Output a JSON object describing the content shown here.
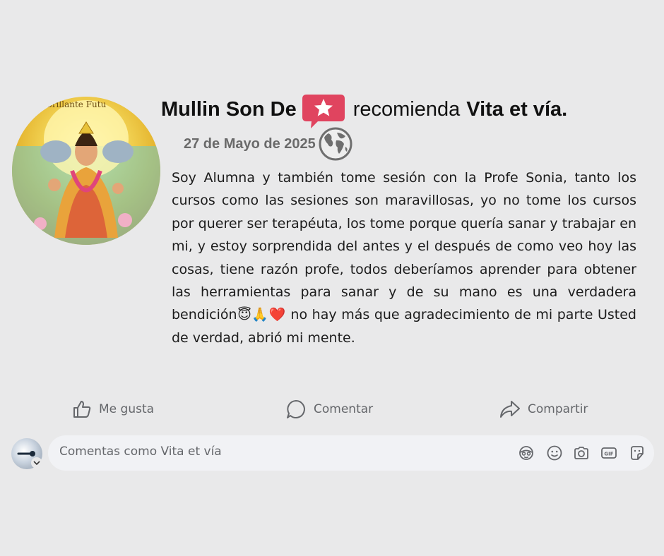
{
  "post": {
    "author": "Mullin Son De",
    "action_text": "recomienda",
    "page_name": "Vita et vía.",
    "date": "27 de Mayo de 2025",
    "avatar_caption": "Brillante Futu",
    "review_text": "Soy Alumna y también tome sesión con la Profe Sonia, tanto los cursos como las sesiones son maravillosas, yo no tome los cursos por querer ser terapéuta, los tome porque quería sanar y trabajar en mi, y estoy sorprendida del antes y el después de como veo hoy las cosas, tiene razón profe, todos deberíamos aprender para obtener las herramientas para sanar y de su mano es una verdadera bendición😇🙏❤️ no hay más que agradecimiento de mi parte Usted de verdad, abrió mi mente."
  },
  "actions": {
    "like_label": "Me gusta",
    "comment_label": "Comentar",
    "share_label": "Compartir"
  },
  "comment_box": {
    "placeholder": "Comentas como Vita et vía"
  },
  "icons": {
    "recommend": "star-speech-bubble-icon",
    "privacy": "globe-icon",
    "like": "thumbs-up-icon",
    "comment": "speech-bubble-icon",
    "share": "share-arrow-icon",
    "avatar_sticker": "avatar-sticker-icon",
    "emoji": "emoji-icon",
    "camera": "camera-icon",
    "gif": "gif-icon",
    "sticker": "sticker-icon"
  },
  "colors": {
    "background": "#e9e9ea",
    "recommend_badge": "#e0445f",
    "muted_text": "#65676b"
  }
}
